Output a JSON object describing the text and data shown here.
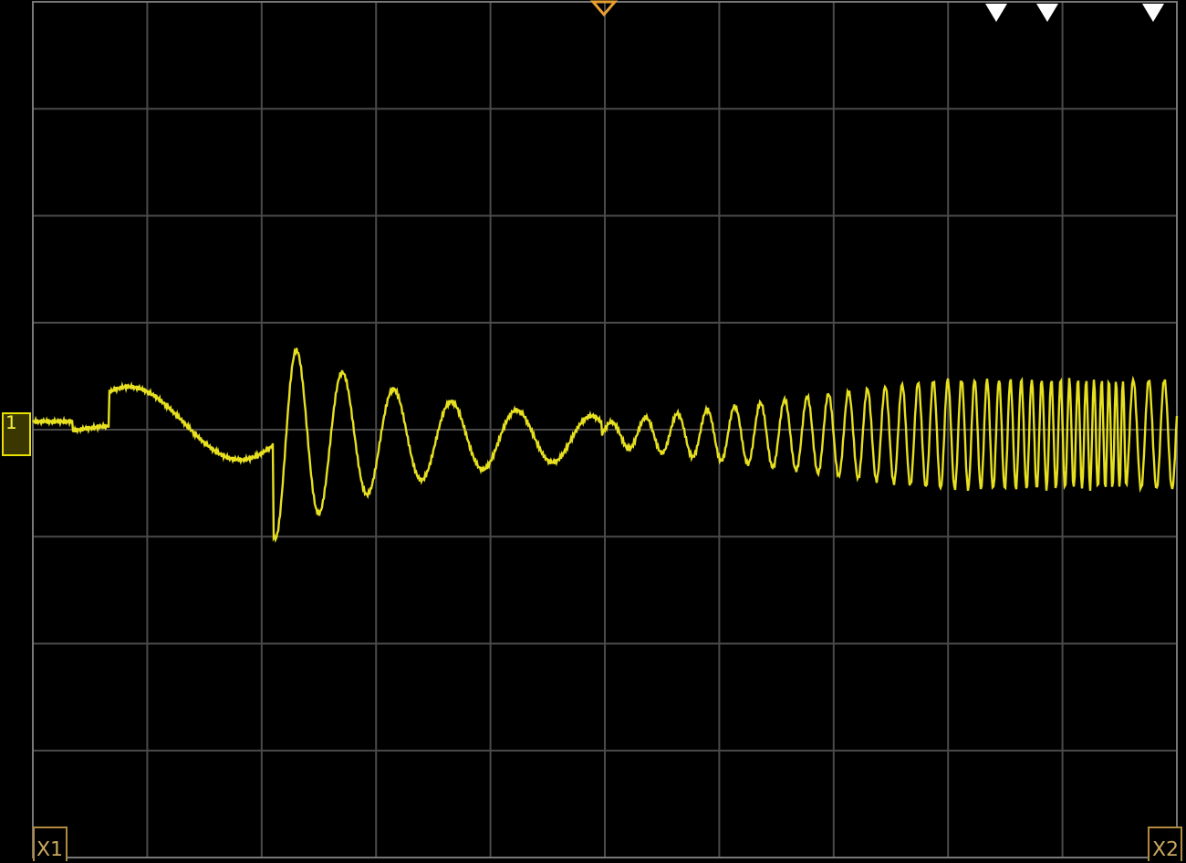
{
  "channel_marker": {
    "label": "1"
  },
  "cursors": [
    {
      "label": "X1"
    },
    {
      "label": "X2"
    }
  ]
}
